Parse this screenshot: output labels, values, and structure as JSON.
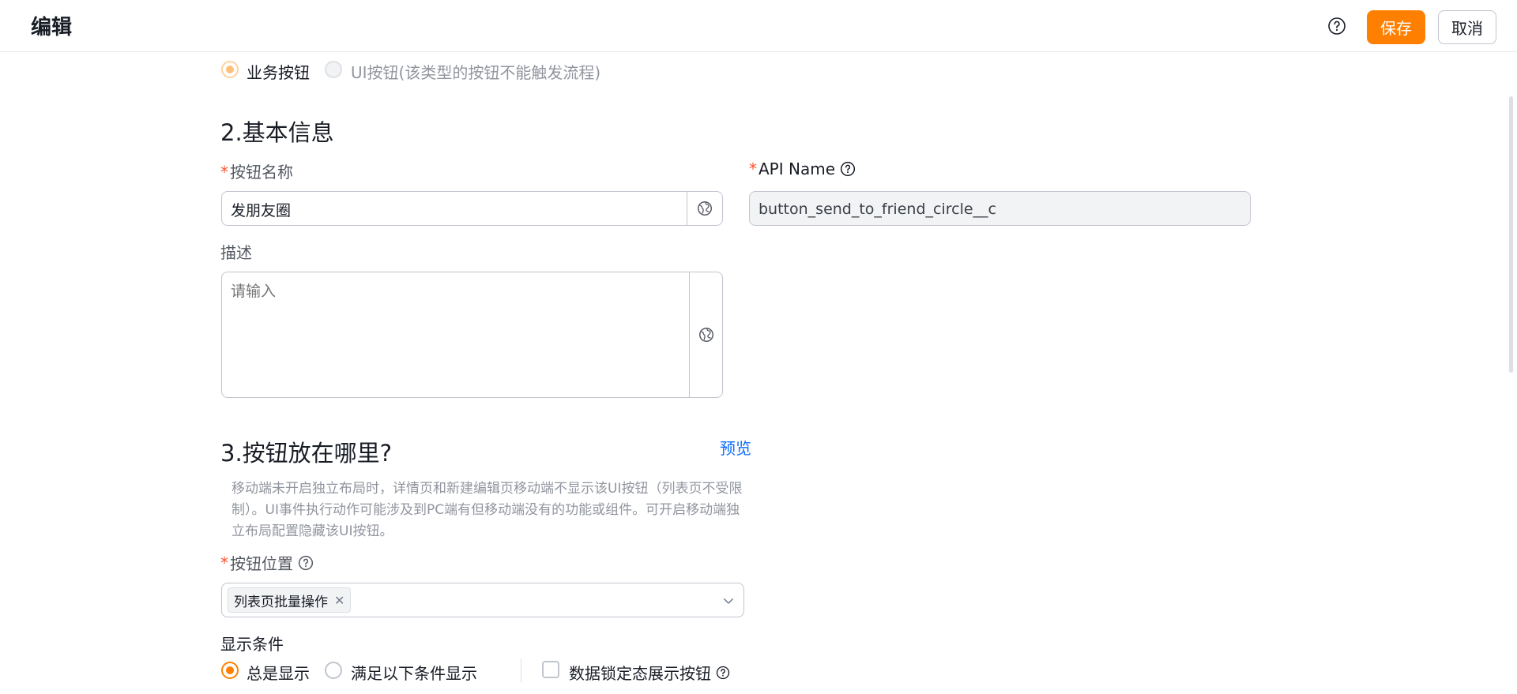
{
  "header": {
    "title": "编辑",
    "save_label": "保存",
    "cancel_label": "取消"
  },
  "button_type": {
    "options": [
      {
        "label": "业务按钮",
        "selected": true
      },
      {
        "label": "UI按钮(该类型的按钮不能触发流程)",
        "selected": false
      }
    ]
  },
  "basic_info": {
    "title": "2.基本信息",
    "name_label": "按钮名称",
    "name_value": "发朋友圈",
    "api_label": "API Name",
    "api_value": "button_send_to_friend_circle__c",
    "desc_label": "描述",
    "desc_placeholder": "请输入"
  },
  "placement": {
    "title": "3.按钮放在哪里?",
    "preview_label": "预览",
    "hint": "移动端未开启独立布局时，详情页和新建编辑页移动端不显示该UI按钮（列表页不受限制）。UI事件执行动作可能涉及到PC端有但移动端没有的功能或组件。可开启移动端独立布局配置隐藏该UI按钮。",
    "position_label": "按钮位置",
    "position_tags": [
      "列表页批量操作"
    ],
    "condition_label": "显示条件",
    "condition_options": [
      {
        "label": "总是显示",
        "selected": true
      },
      {
        "label": "满足以下条件显示",
        "selected": false
      }
    ],
    "lock_label": "数据锁定态展示按钮"
  },
  "colors": {
    "accent": "#ff8000",
    "link": "#0c6cff",
    "required": "#ff522a"
  }
}
